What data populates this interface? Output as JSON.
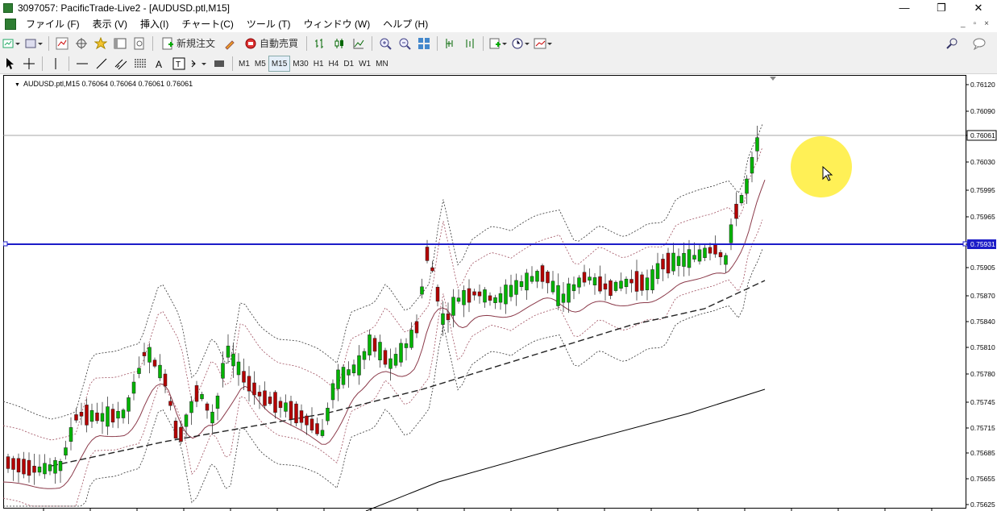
{
  "window": {
    "title": "3097057: PacificTrade-Live2 - [AUDUSD.ptl,M15]",
    "minimize": "—",
    "maximize": "❐",
    "close": "✕"
  },
  "menu": {
    "items": [
      "ファイル (F)",
      "表示 (V)",
      "挿入(I)",
      "チャート(C)",
      "ツール (T)",
      "ウィンドウ (W)",
      "ヘルプ (H)"
    ],
    "mdi_controls": [
      "_",
      "▫",
      "×"
    ]
  },
  "toolbar": {
    "new_order": "新規注文",
    "auto_trading": "自動売買"
  },
  "timeframes": [
    "M1",
    "M5",
    "M15",
    "M30",
    "H1",
    "H4",
    "D1",
    "W1",
    "MN"
  ],
  "active_timeframe": "M15",
  "chart": {
    "symbol_label": "AUDUSD.ptl,M15  0.76064 0.76064 0.76061 0.76061",
    "price_ticks": [
      "0.76120",
      "0.76090",
      "0.76061",
      "0.76030",
      "0.75995",
      "0.75965",
      "0.75931",
      "0.75905",
      "0.75870",
      "0.75840",
      "0.75810",
      "0.75780",
      "0.75745",
      "0.75715",
      "0.75685",
      "0.75655",
      "0.75625"
    ],
    "current_price": "0.76061",
    "hline_price": "0.75931",
    "colors": {
      "bull": "#00b400",
      "bear": "#b40000",
      "hline": "#1c1cc8",
      "bands": "#000000",
      "ma": "#a05060",
      "axis": "#000000",
      "highlight": "#ffee44"
    }
  }
}
